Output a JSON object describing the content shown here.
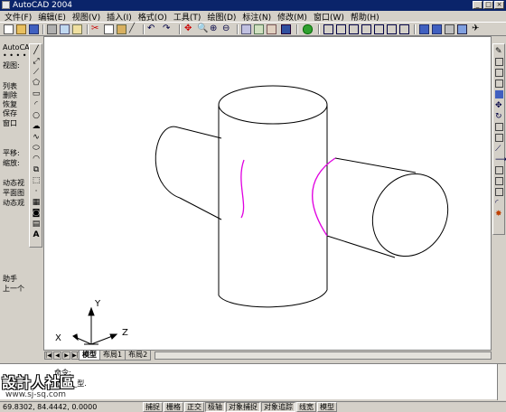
{
  "window": {
    "title": "AutoCAD 2004",
    "min": "_",
    "max": "□",
    "close": "×"
  },
  "menu": [
    "文件(F)",
    "编辑(E)",
    "视图(V)",
    "插入(I)",
    "格式(O)",
    "工具(T)",
    "绘图(D)",
    "标注(N)",
    "修改(M)",
    "窗口(W)",
    "帮助(H)"
  ],
  "left_panel": {
    "header": "AutoCAD",
    "dots": "• • • •",
    "view_label": "视图:",
    "items": [
      "列表",
      "删除",
      "恢复",
      "保存",
      "窗口"
    ],
    "pan": "平移:",
    "zoom": "缩放:",
    "dynamic": [
      "动态视",
      "平面图",
      "动态观"
    ],
    "help": [
      "助手",
      "上一个"
    ]
  },
  "axes": {
    "y": "Y",
    "z": "Z",
    "x": "X"
  },
  "layout_tabs": [
    "模型",
    "布局1",
    "布局2"
  ],
  "command": {
    "line1": "命令:",
    "line2": "命令: _型."
  },
  "watermark": {
    "brand": "設計人社區",
    "url": "www.sj-sq.com"
  },
  "status": {
    "coords": "69.8302,  84.4442, 0.0000",
    "buttons": [
      "捕捉",
      "栅格",
      "正交",
      "极轴",
      "对象捕捉",
      "对象追踪",
      "线宽",
      "模型"
    ]
  },
  "colors": {
    "title_bar": "#0a246a",
    "face": "#d4d0c8",
    "canvas": "#ffffff",
    "intersection_curve": "#e000e0"
  }
}
